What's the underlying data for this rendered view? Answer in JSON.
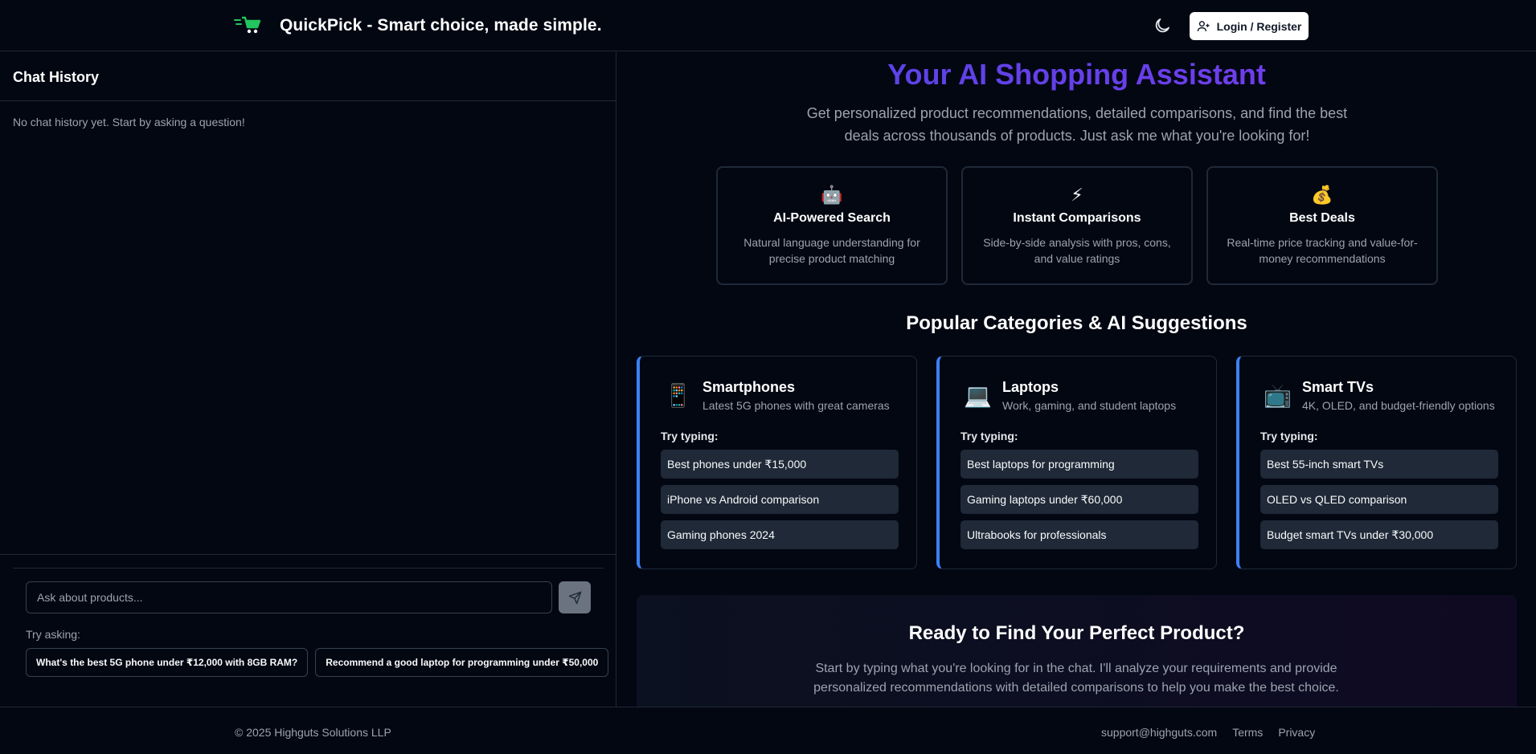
{
  "header": {
    "brand": "QuickPick - Smart choice, made simple.",
    "login_label": "Login / Register",
    "logo_icon": "cart-icon",
    "theme_icon": "moon-icon",
    "accent": "#22c55e"
  },
  "sidebar": {
    "title": "Chat History",
    "empty_text": "No chat history yet. Start by asking a question!",
    "input_placeholder": "Ask about products...",
    "try_label": "Try asking:",
    "suggestions": [
      "What's the best 5G phone under ₹12,000 with 8GB RAM?",
      "Recommend a good laptop for programming under ₹50,000"
    ]
  },
  "hero": {
    "title": "Your AI Shopping Assistant",
    "subtitle": "Get personalized product recommendations, detailed comparisons, and find the best deals across thousands of products. Just ask me what you're looking for!"
  },
  "features": [
    {
      "icon": "🤖",
      "title": "AI-Powered Search",
      "desc": "Natural language understanding for precise product matching"
    },
    {
      "icon": "⚡",
      "title": "Instant Comparisons",
      "desc": "Side-by-side analysis with pros, cons, and value ratings"
    },
    {
      "icon": "💰",
      "title": "Best Deals",
      "desc": "Real-time price tracking and value-for-money recommendations"
    }
  ],
  "categories_heading": "Popular Categories & AI Suggestions",
  "categories": [
    {
      "icon": "📱",
      "name": "Smartphones",
      "desc": "Latest 5G phones with great cameras",
      "try_label": "Try typing:",
      "prompts": [
        "Best phones under ₹15,000",
        "iPhone vs Android comparison",
        "Gaming phones 2024"
      ]
    },
    {
      "icon": "💻",
      "name": "Laptops",
      "desc": "Work, gaming, and student laptops",
      "try_label": "Try typing:",
      "prompts": [
        "Best laptops for programming",
        "Gaming laptops under ₹60,000",
        "Ultrabooks for professionals"
      ]
    },
    {
      "icon": "📺",
      "name": "Smart TVs",
      "desc": "4K, OLED, and budget-friendly options",
      "try_label": "Try typing:",
      "prompts": [
        "Best 55-inch smart TVs",
        "OLED vs QLED comparison",
        "Budget smart TVs under ₹30,000"
      ]
    }
  ],
  "cta": {
    "title": "Ready to Find Your Perfect Product?",
    "desc": "Start by typing what you're looking for in the chat. I'll analyze your requirements and provide personalized recommendations with detailed comparisons to help you make the best choice."
  },
  "footer": {
    "copyright": "© 2025 Highguts Solutions LLP",
    "email": "support@highguts.com",
    "terms": "Terms",
    "privacy": "Privacy"
  }
}
